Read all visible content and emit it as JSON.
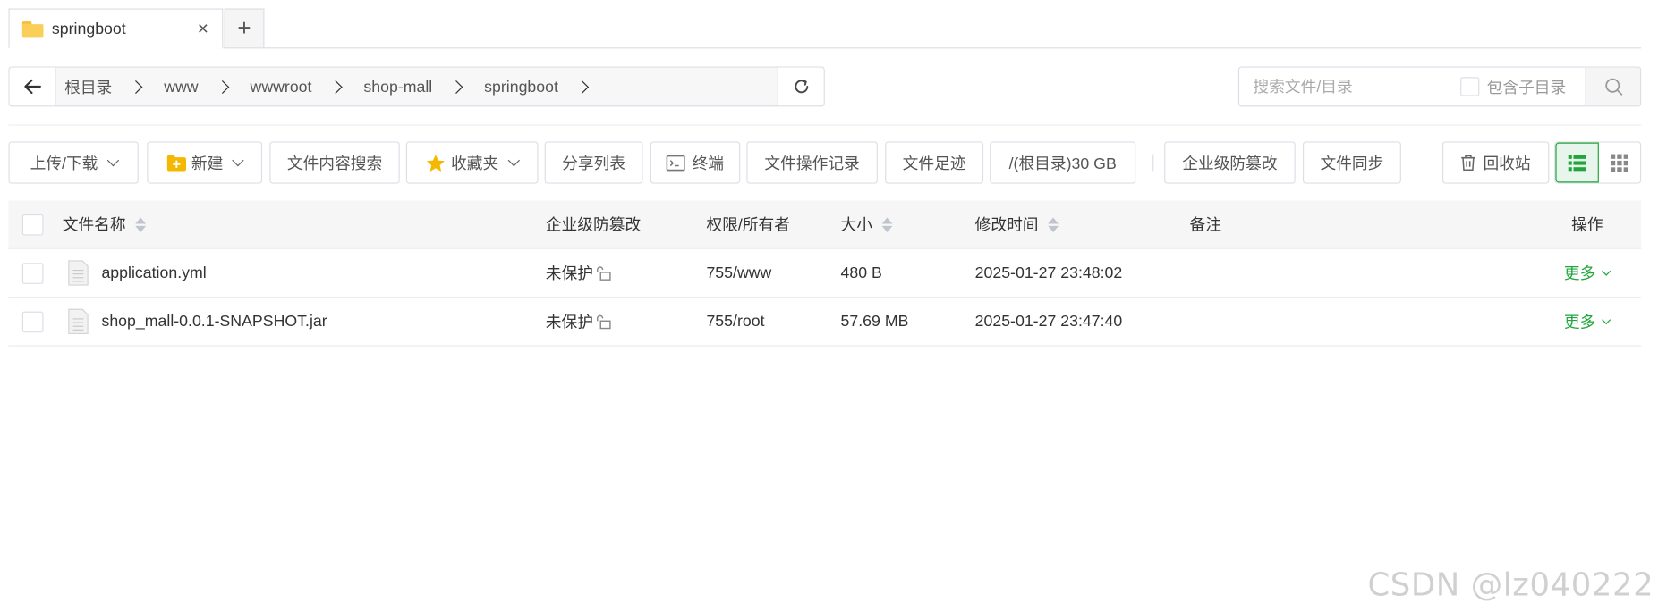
{
  "tabs": [
    {
      "label": "springboot"
    }
  ],
  "tab_close": "×",
  "tab_add": "+",
  "breadcrumb": [
    "根目录",
    "www",
    "wwwroot",
    "shop-mall",
    "springboot"
  ],
  "search": {
    "placeholder": "搜索文件/目录",
    "include_subdir_label": "包含子目录"
  },
  "toolbar": {
    "upload_download": "上传/下载",
    "new": "新建",
    "content_search": "文件内容搜索",
    "favorites": "收藏夹",
    "share_list": "分享列表",
    "terminal": "终端",
    "operation_log": "文件操作记录",
    "footprint": "文件足迹",
    "disk_usage": "/(根目录)30 GB",
    "tamper_protection": "企业级防篡改",
    "file_sync": "文件同步",
    "recycle_bin": "回收站"
  },
  "table": {
    "headers": {
      "name": "文件名称",
      "protection": "企业级防篡改",
      "permission": "权限/所有者",
      "size": "大小",
      "modified": "修改时间",
      "remark": "备注",
      "actions": "操作"
    },
    "rows": [
      {
        "name": "application.yml",
        "protection": "未保护",
        "permission": "755/www",
        "size": "480 B",
        "modified": "2025-01-27 23:48:02",
        "remark": "",
        "action": "更多"
      },
      {
        "name": "shop_mall-0.0.1-SNAPSHOT.jar",
        "protection": "未保护",
        "permission": "755/root",
        "size": "57.69 MB",
        "modified": "2025-01-27 23:47:40",
        "remark": "",
        "action": "更多"
      }
    ]
  },
  "watermark": "CSDN @lz040222",
  "colors": {
    "accent_green": "#20a53a",
    "folder_yellow": "#f9cf57",
    "border": "#dcdfe6"
  }
}
